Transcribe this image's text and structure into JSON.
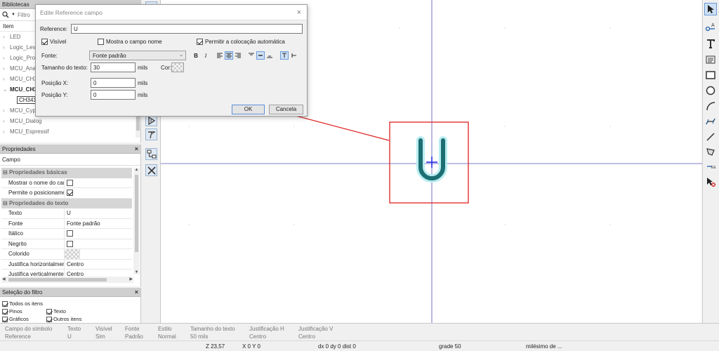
{
  "libraries": {
    "title": "Bibliotecas",
    "search_placeholder": "Filtro",
    "column_header": "Item",
    "items": [
      {
        "label": "LED",
        "expanded": false,
        "bold": false
      },
      {
        "label": "Logic_Leve",
        "expanded": false,
        "bold": false
      },
      {
        "label": "Logic_Prog",
        "expanded": false,
        "bold": false
      },
      {
        "label": "MCU_Analo",
        "expanded": false,
        "bold": false
      },
      {
        "label": "MCU_CH32",
        "expanded": false,
        "bold": false
      },
      {
        "label": "MCU_CH34",
        "expanded": true,
        "bold": true
      },
      {
        "label": "CH341",
        "child": true
      },
      {
        "label": "MCU_Cypr",
        "expanded": false,
        "bold": false
      },
      {
        "label": "MCU_Dialog",
        "expanded": false,
        "bold": false
      },
      {
        "label": "MCU_Espressif",
        "expanded": false,
        "bold": false
      }
    ]
  },
  "properties": {
    "title": "Propriedades",
    "subtitle": "Campo",
    "basic_header": "Propriedades básicas",
    "basic": [
      {
        "key": "Mostrar o nome do cam...",
        "value": "",
        "checkbox": true,
        "checked": false
      },
      {
        "key": "Permite o posicioname...",
        "value": "",
        "checkbox": true,
        "checked": true
      }
    ],
    "text_header": "Propriedades do texto",
    "text": [
      {
        "key": "Texto",
        "value": "U"
      },
      {
        "key": "Fonte",
        "value": "Fonte padrão"
      },
      {
        "key": "Itálico",
        "value": "",
        "checkbox": true,
        "checked": false
      },
      {
        "key": "Negrito",
        "value": "",
        "checkbox": true,
        "checked": false
      },
      {
        "key": "Colorido",
        "value": "",
        "swatch": true
      },
      {
        "key": "Justifica horizontalmente",
        "value": "Centro"
      },
      {
        "key": "Justifica verticalmente",
        "value": "Centro"
      }
    ]
  },
  "filter": {
    "title": "Seleção do filtro",
    "items": [
      {
        "label": "Todos os itens",
        "checked": true
      },
      {
        "label": "Pinos",
        "checked": true
      },
      {
        "label": "Texto",
        "checked": true
      },
      {
        "label": "Gráficos",
        "checked": true
      },
      {
        "label": "Outros itens",
        "checked": true
      }
    ]
  },
  "dialog": {
    "title": "Edite Reference campo",
    "reference_label": "Reference:",
    "reference_value": "U",
    "visible_label": "Visível",
    "show_name_label": "Mostra o campo nome",
    "auto_place_label": "Permitir a colocação automática",
    "font_label": "Fonte:",
    "font_value": "Fonte padrão",
    "bold_label": "B",
    "italic_label": "I",
    "text_size_label": "Tamanho do texto:",
    "text_size_value": "30",
    "units": "mils",
    "color_label": "Cor:",
    "pos_x_label": "Posição X:",
    "pos_x_value": "0",
    "pos_y_label": "Posição Y:",
    "pos_y_value": "0",
    "ok_label": "OK",
    "cancel_label": "Cancela"
  },
  "canvas": {
    "symbol_text": "U",
    "accent_color": "#e60000",
    "symbol_color": "#1c6e72"
  },
  "message_panel": {
    "columns": [
      {
        "title": "Campo do símbolo",
        "value": "Reference"
      },
      {
        "title": "Texto",
        "value": "U"
      },
      {
        "title": "Visível",
        "value": "Sim"
      },
      {
        "title": "Fonte",
        "value": "Padrão"
      },
      {
        "title": "Estilo",
        "value": "Normal"
      },
      {
        "title": "Tamanho do texto",
        "value": "50 mils"
      },
      {
        "title": "Justificação H",
        "value": "Centro"
      },
      {
        "title": "Justificação V",
        "value": "Centro"
      }
    ]
  },
  "status_bar": {
    "zoom": "Z 23,57",
    "coords": "X 0  Y 0",
    "delta": "dx 0  dy 0  dist 0",
    "grid": "grade 50",
    "units": "milésimo de ..."
  }
}
